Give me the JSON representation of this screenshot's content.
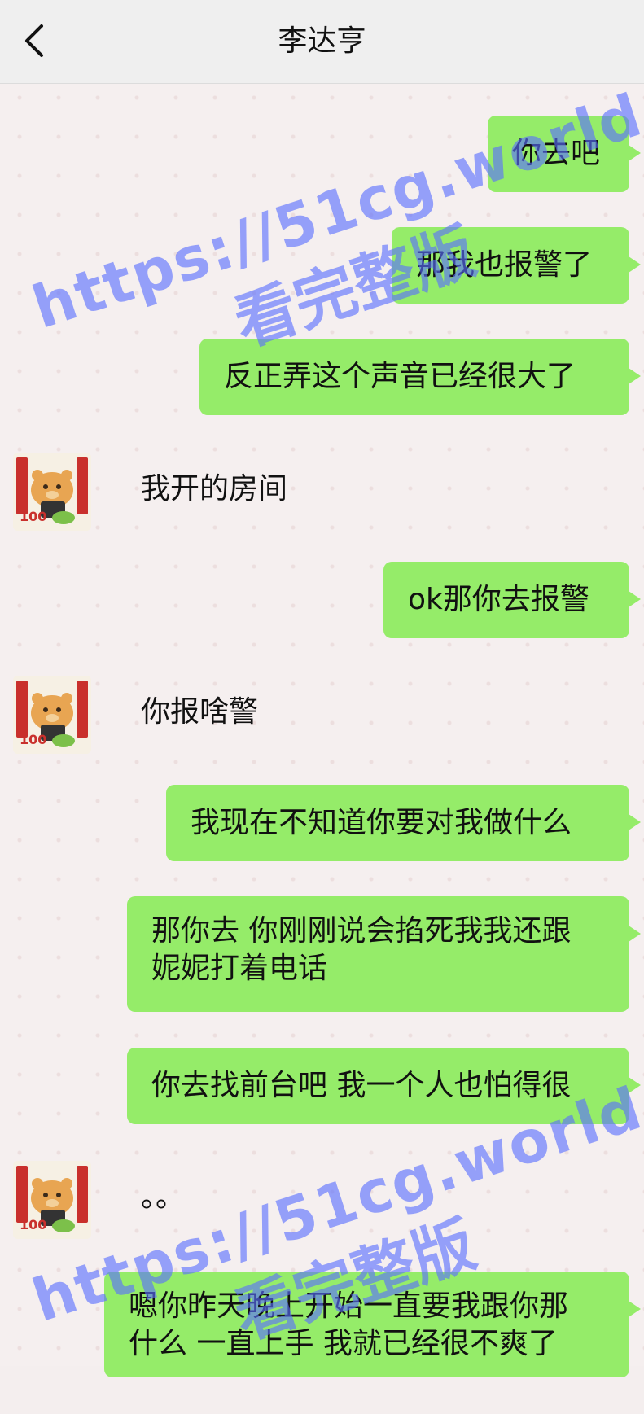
{
  "header": {
    "title": "李达亨",
    "back_icon": "chevron-left-icon"
  },
  "messages": [
    {
      "side": "right",
      "text": "你去吧"
    },
    {
      "side": "right",
      "text": "那我也报警了"
    },
    {
      "side": "right",
      "text": "反正弄这个声音已经很大了"
    },
    {
      "side": "left",
      "text": "我开的房间"
    },
    {
      "side": "right",
      "text": "ok那你去报警"
    },
    {
      "side": "left",
      "text": "你报啥警"
    },
    {
      "side": "right",
      "text": "我现在不知道你要对我做什么"
    },
    {
      "side": "right",
      "lines": [
        "那你去 你刚刚说会掐死我我还跟",
        "妮妮打着电话"
      ]
    },
    {
      "side": "right",
      "text": "你去找前台吧 我一个人也怕得很"
    },
    {
      "side": "left",
      "text": "。。"
    },
    {
      "side": "right",
      "lines": [
        "嗯你昨天晚上开始一直要我跟你那",
        "什么 一直上手 我就已经很不爽了"
      ]
    }
  ],
  "avatar": {
    "badge_text": "100",
    "icon": "bear-sticker-avatar-icon"
  },
  "watermark": {
    "url": "https://51cg.world",
    "sub": "看完整版"
  },
  "colors": {
    "bubble": "#95ec69",
    "watermark": "#5a6eff"
  }
}
